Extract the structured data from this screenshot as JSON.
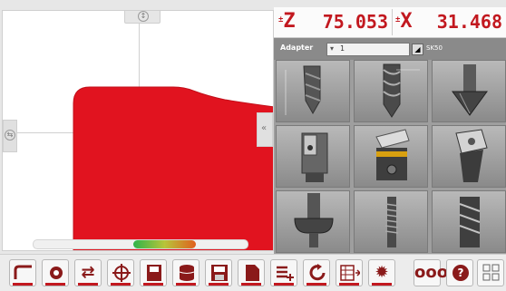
{
  "readout": {
    "z_label": "Z",
    "z_value": "75.053",
    "x_label": "X",
    "x_value": "31.468",
    "color": "#c2181f"
  },
  "viewport": {
    "progress": 0.55,
    "part_color": "#e1131f",
    "progress_colors": [
      "#2fb34a",
      "#b8c43a",
      "#e0601e"
    ],
    "handles": [
      "top-handle-icon",
      "left-handle-icon",
      "right-collapse-icon"
    ]
  },
  "tool_panel": {
    "adapter_label": "Adapter",
    "adapter_value": "1",
    "material_label": "SK50",
    "tools": [
      {
        "icon": "twist-drill-icon"
      },
      {
        "icon": "spiral-drill-icon"
      },
      {
        "icon": "countersink-icon"
      },
      {
        "icon": "insert-drill-icon"
      },
      {
        "icon": "boring-bar-icon"
      },
      {
        "icon": "chamfer-insert-icon"
      },
      {
        "icon": "corner-radius-cutter-icon"
      },
      {
        "icon": "thread-tap-icon"
      },
      {
        "icon": "end-mill-icon"
      }
    ]
  },
  "toolbar": {
    "buttons": [
      {
        "icon": "contour-icon"
      },
      {
        "icon": "gear-part-icon"
      },
      {
        "icon": "swap-icon"
      },
      {
        "icon": "crosshair-icon"
      },
      {
        "icon": "save-program-icon"
      },
      {
        "icon": "database-icon"
      },
      {
        "icon": "save-icon"
      },
      {
        "icon": "document-icon"
      },
      {
        "icon": "list-add-icon"
      },
      {
        "icon": "refresh-icon"
      },
      {
        "icon": "table-export-icon"
      },
      {
        "icon": "gear-icon"
      },
      {
        "icon": "more-icon"
      },
      {
        "icon": "help-icon"
      },
      {
        "icon": "grid-menu-icon"
      }
    ],
    "accent": "#c2181f"
  }
}
